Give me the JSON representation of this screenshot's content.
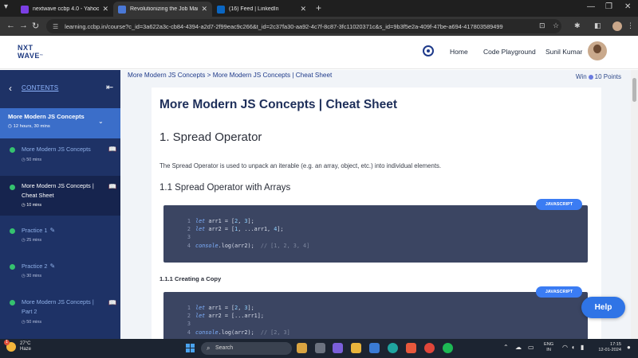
{
  "browser": {
    "tabs": [
      {
        "label": "nextwave ccbp 4.0 - Yahoo Indi",
        "active": false,
        "favicon_color": "#7b3fe4"
      },
      {
        "label": "Revolutionizing the Job Market",
        "active": true,
        "favicon_color": "#4a78d6"
      },
      {
        "label": "(16) Feed | LinkedIn",
        "active": false,
        "favicon_color": "#0a66c2"
      }
    ],
    "url": "learning.ccbp.in/course?c_id=3a622a3c-cb84-4394-a2d7-2f99eac9c266&t_id=2c37fa30-aa92-4c7f-8c87-3fc11020371c&s_id=9b3f5e2a-409f-47be-a694-417803589499"
  },
  "header": {
    "logo_top": "NXT",
    "logo_bottom": "WAVE",
    "nav": [
      "Home",
      "Code Playground"
    ],
    "user_name": "Sunil Kumar"
  },
  "sidebar": {
    "title": "CONTENTS",
    "module": {
      "title": "More Modern JS Concepts",
      "duration": "12 hours, 30 mins"
    },
    "items": [
      {
        "label": "More Modern JS Concepts",
        "duration": "50 mins",
        "active": false,
        "icon": "book-icon"
      },
      {
        "label": "More Modern JS Concepts | Cheat Sheet",
        "duration": "10 mins",
        "active": true,
        "icon": "book-icon"
      },
      {
        "label": "Practice 1",
        "duration": "25 mins",
        "active": false,
        "icon": "edit-icon"
      },
      {
        "label": "Practice 2",
        "duration": "30 mins",
        "active": false,
        "icon": "edit-icon"
      },
      {
        "label": "More Modern JS Concepts | Part 2",
        "duration": "50 mins",
        "active": false,
        "icon": "book-icon"
      }
    ]
  },
  "content": {
    "breadcrumb": "More Modern JS Concepts > More Modern JS Concepts | Cheat Sheet",
    "points_prefix": "Win",
    "points_value": "10 Points",
    "title": "More Modern JS Concepts | Cheat Sheet",
    "section_1": "1. Spread Operator",
    "section_1_text": "The Spread Operator is used to unpack an iterable (e.g. an array, object, etc.) into individual elements.",
    "section_1_1": "1.1 Spread Operator with Arrays",
    "section_1_1_1": "1.1.1 Creating a Copy",
    "code_badge": "JAVASCRIPT",
    "code_block_1": {
      "line_numbers": [
        "1",
        "2",
        "3",
        "4"
      ],
      "lines": [
        "let arr1 = [2, 3];",
        "let arr2 = [1, ...arr1, 4];",
        "",
        "console.log(arr2);  // [1, 2, 3, 4]"
      ]
    },
    "code_block_2": {
      "line_numbers": [
        "1",
        "2",
        "3",
        "4"
      ],
      "lines": [
        "let arr1 = [2, 3];",
        "let arr2 = [...arr1];",
        "",
        "console.log(arr2);  // [2, 3]"
      ]
    },
    "help_label": "Help"
  },
  "taskbar": {
    "temperature": "27°C",
    "weather": "Haze",
    "weather_badge": "1",
    "search_placeholder": "Search",
    "lang_top": "ENG",
    "lang_bottom": "IN",
    "time": "17:15",
    "date": "12-01-2024"
  }
}
